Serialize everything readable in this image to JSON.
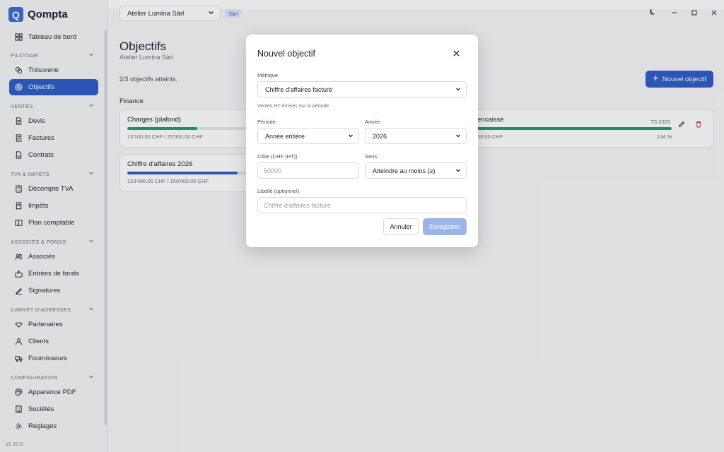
{
  "app": {
    "name": "Qompta",
    "logo_letter": "Q",
    "version": "v1.20.5"
  },
  "sidebar": {
    "top_item": {
      "label": "Tableau de bord",
      "icon": "dashboard-icon"
    },
    "sections": [
      {
        "label": "PILOTAGE",
        "items": [
          {
            "label": "Trésorerie",
            "icon": "coins-icon"
          },
          {
            "label": "Objectifs",
            "icon": "target-icon",
            "active": true
          }
        ]
      },
      {
        "label": "VENTES",
        "items": [
          {
            "label": "Devis",
            "icon": "document-icon"
          },
          {
            "label": "Factures",
            "icon": "invoice-icon"
          },
          {
            "label": "Contrats",
            "icon": "contract-icon"
          }
        ]
      },
      {
        "label": "TVA & IMPÔTS",
        "items": [
          {
            "label": "Décompte TVA",
            "icon": "calculator-icon"
          },
          {
            "label": "Impôts",
            "icon": "receipt-icon"
          },
          {
            "label": "Plan comptable",
            "icon": "book-icon"
          }
        ]
      },
      {
        "label": "ASSOCIÉS & FONDS",
        "items": [
          {
            "label": "Associés",
            "icon": "users-icon"
          },
          {
            "label": "Entrées de fonds",
            "icon": "cash-in-icon"
          },
          {
            "label": "Signatures",
            "icon": "signature-icon"
          }
        ]
      },
      {
        "label": "CARNET D'ADRESSES",
        "items": [
          {
            "label": "Partenaires",
            "icon": "handshake-icon"
          },
          {
            "label": "Clients",
            "icon": "user-icon"
          },
          {
            "label": "Fournisseurs",
            "icon": "truck-icon"
          }
        ]
      },
      {
        "label": "CONFIGURATION",
        "items": [
          {
            "label": "Apparence PDF",
            "icon": "palette-icon"
          },
          {
            "label": "Sociétés",
            "icon": "building-icon"
          },
          {
            "label": "Réglages",
            "icon": "gear-icon"
          }
        ]
      }
    ]
  },
  "header": {
    "company": "Atelier Lumina Sàrl",
    "company_type_badge": "Sàrl"
  },
  "main": {
    "title": "Objectifs",
    "subtitle": "Atelier Lumina Sàrl",
    "achieved_text": "2/3 objectifs atteints.",
    "new_button": "Nouvel objectif",
    "group_title": "Finance",
    "cards": [
      {
        "title": "Charges (plafond)",
        "values": "13'100.00 CHF / 25'000.00 CHF",
        "progress": 0.52,
        "color": "#1f9d6b"
      },
      {
        "title": "Chiffre d'affaires 2026",
        "values": "123'480.00 CHF / 150'000.00 CHF",
        "progress": 0.82,
        "color": "#2f5ec8"
      },
      {
        "title": "encaissé",
        "values": "00.00 CHF",
        "period": "T3 2026",
        "percent": "134 %",
        "progress": 1.0,
        "color": "#1f9d6b"
      }
    ]
  },
  "modal": {
    "title": "Nouvel objectif",
    "metric_label": "Métrique",
    "metric_value": "Chiffre d'affaires facturé",
    "metric_hint": "Ventes HT émises sur la période.",
    "period_label": "Période",
    "period_value": "Année entière",
    "year_label": "Année",
    "year_value": "2026",
    "target_label": "Cible (CHF (HT))",
    "target_placeholder": "50000",
    "direction_label": "Sens",
    "direction_value": "Atteindre au moins (≥)",
    "caption_label": "Libellé (optionnel)",
    "caption_placeholder": "Chiffre d'affaires facturé",
    "cancel": "Annuler",
    "save": "Enregistrer"
  }
}
